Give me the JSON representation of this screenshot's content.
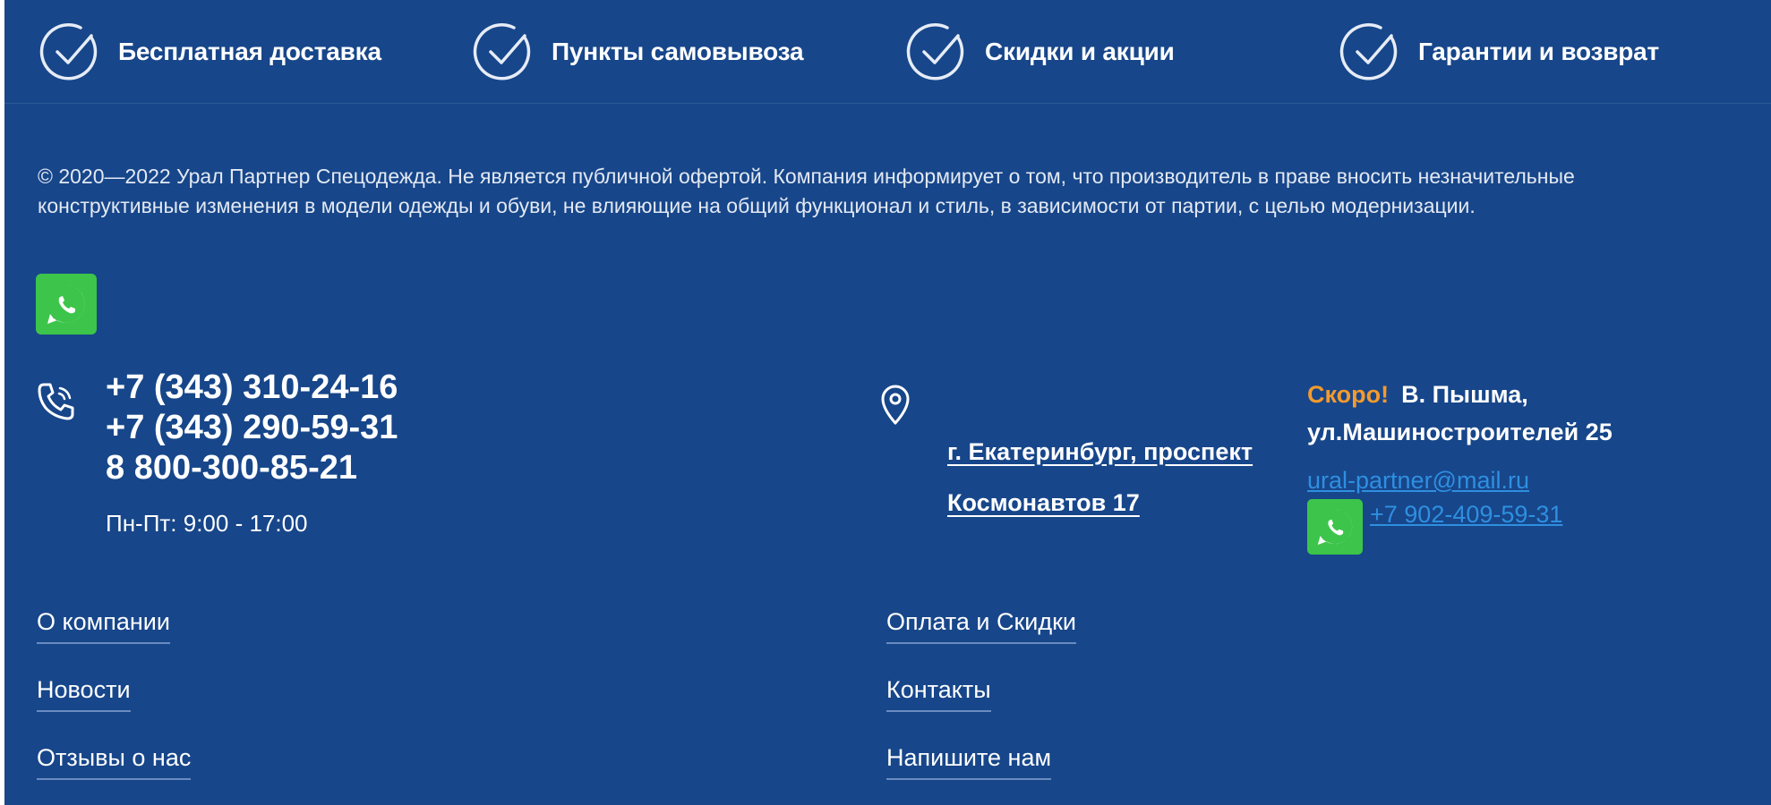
{
  "features": [
    {
      "label": "Бесплатная доставка",
      "icon": "check-circle-icon"
    },
    {
      "label": "Пункты самовывоза",
      "icon": "check-circle-icon"
    },
    {
      "label": "Скидки и акции",
      "icon": "check-circle-icon"
    },
    {
      "label": "Гарантии и возврат",
      "icon": "check-circle-icon"
    }
  ],
  "copyright": "© 2020—2022 Урал Партнер Спецодежда. Не является публичной офертой. Компания информирует о том, что производитель в праве вносить незначительные конструктивные изменения в модели одежды и обуви, не влияющие на общий функционал и стиль, в зависимости от партии, с целью модернизации.",
  "contacts": {
    "phones": [
      "+7 (343) 310-24-16",
      "+7 (343) 290-59-31",
      "8 800-300-85-21"
    ],
    "hours": "Пн-Пт: 9:00 - 17:00",
    "address_line1": "г. Екатеринбург, проспект",
    "address_line2": "Космонавтов 17",
    "soon_tag": "Скоро!",
    "soon_city": "В. Пышма,",
    "soon_street": "ул.Машиностроителей 25",
    "email": "ural-partner@mail.ru",
    "whatsapp_number": "+7 902-409-59-31"
  },
  "nav": {
    "left": [
      "О компании",
      "Новости",
      "Отзывы о нас"
    ],
    "right": [
      "Оплата и Скидки",
      "Контакты",
      "Напишите нам"
    ]
  },
  "colors": {
    "background": "#17468a",
    "accent_orange": "#f39a2e",
    "link_blue": "#2f8fe0",
    "whatsapp_green": "#3cc54a"
  },
  "icons": [
    "check-circle-icon",
    "whatsapp-icon",
    "phone-icon",
    "map-pin-icon"
  ]
}
